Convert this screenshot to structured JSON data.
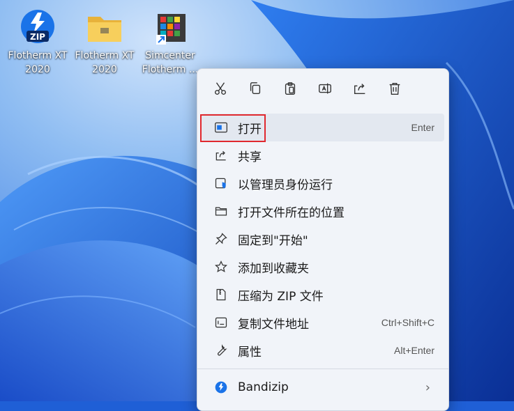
{
  "desktop": {
    "icons": [
      {
        "label": "Flotherm XT\n2020",
        "icon": "zip-icon"
      },
      {
        "label": "Flotherm XT\n2020",
        "icon": "folder-icon"
      },
      {
        "label": "Simcenter\nFlotherm ...",
        "icon": "shortcut-app-icon"
      }
    ]
  },
  "context_menu": {
    "quick_actions": [
      {
        "name": "cut",
        "icon": "scissors-icon"
      },
      {
        "name": "copy",
        "icon": "copy-icon"
      },
      {
        "name": "paste",
        "icon": "clipboard-icon"
      },
      {
        "name": "rename",
        "icon": "rename-icon"
      },
      {
        "name": "share",
        "icon": "share-icon"
      },
      {
        "name": "delete",
        "icon": "trash-icon"
      }
    ],
    "items": [
      {
        "label": "打开",
        "shortcut": "Enter",
        "icon": "open-window-icon"
      },
      {
        "label": "共享",
        "shortcut": "",
        "icon": "share-icon"
      },
      {
        "label": "以管理员身份运行",
        "shortcut": "",
        "icon": "shield-icon"
      },
      {
        "label": "打开文件所在的位置",
        "shortcut": "",
        "icon": "folder-outline-icon"
      },
      {
        "label": "固定到\"开始\"",
        "shortcut": "",
        "icon": "pin-icon"
      },
      {
        "label": "添加到收藏夹",
        "shortcut": "",
        "icon": "star-icon"
      },
      {
        "label": "压缩为 ZIP 文件",
        "shortcut": "",
        "icon": "zip-file-icon"
      },
      {
        "label": "复制文件地址",
        "shortcut": "Ctrl+Shift+C",
        "icon": "path-icon"
      },
      {
        "label": "属性",
        "shortcut": "Alt+Enter",
        "icon": "wrench-icon"
      }
    ],
    "extra_items": [
      {
        "label": "Bandizip",
        "icon": "bandizip-icon",
        "submenu_indicator": "›"
      }
    ]
  },
  "colors": {
    "accent": "#0067c0",
    "highlight_border": "#e0282e",
    "menu_bg": "#f1f4f9"
  }
}
